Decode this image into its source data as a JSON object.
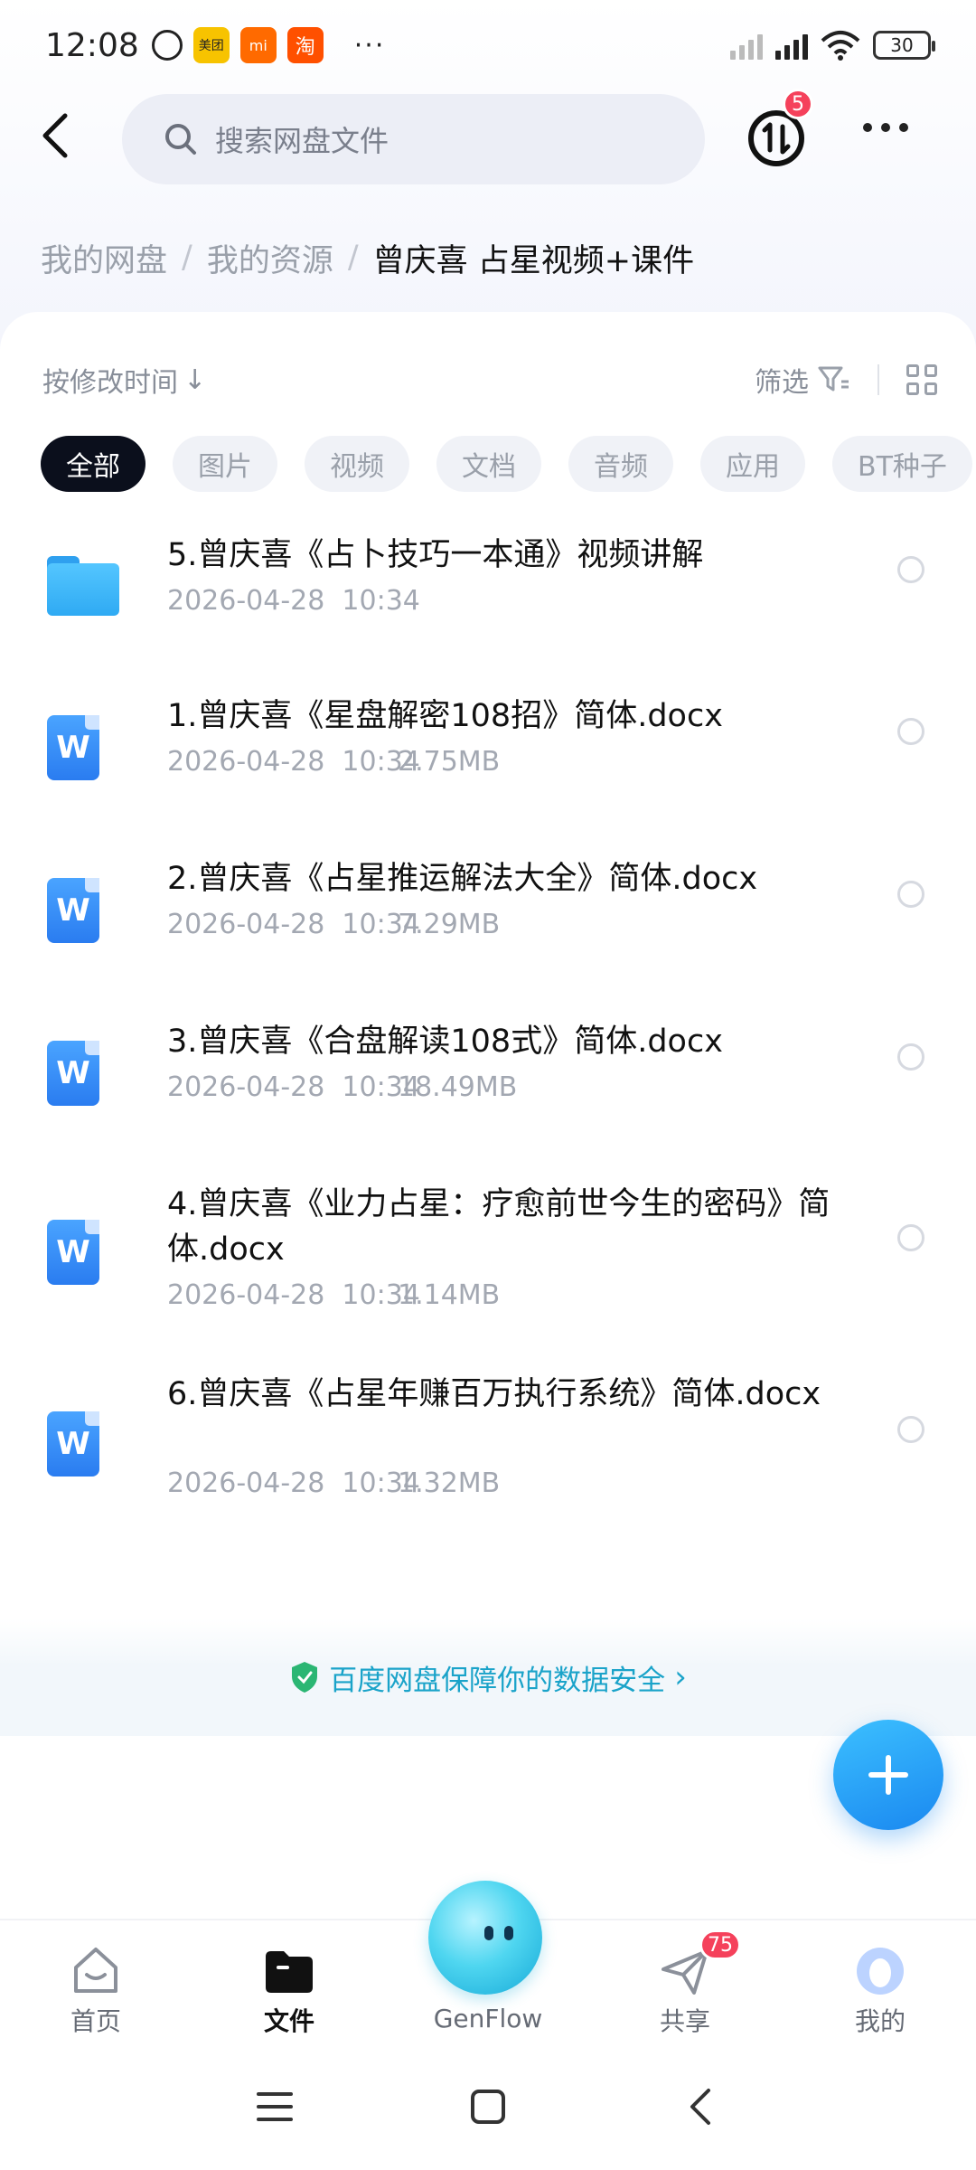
{
  "status_bar": {
    "time": "12:08",
    "app_icons": [
      "alarm-icon",
      "meituan-icon",
      "mi-icon",
      "taobao-icon"
    ],
    "meituan_label": "美团",
    "mi_label": "mi",
    "taobao_label": "淘",
    "more": "···",
    "battery": "30"
  },
  "header": {
    "search_placeholder": "搜索网盘文件",
    "transfer_badge": "5"
  },
  "breadcrumb": {
    "items": [
      "我的网盘",
      "我的资源",
      "曾庆喜 占星视频+课件"
    ],
    "separator": "/"
  },
  "toolbar": {
    "sort_label": "按修改时间",
    "sort_arrow": "↓",
    "filter_label": "筛选"
  },
  "chips": [
    "全部",
    "图片",
    "视频",
    "文档",
    "音频",
    "应用",
    "BT种子"
  ],
  "files": [
    {
      "type": "folder",
      "name": "5.曾庆喜《占卜技巧一本通》视频讲解",
      "date": "2026-04-28  10:34",
      "size": ""
    },
    {
      "type": "doc",
      "name": "1.曾庆喜《星盘解密108招》简体.docx",
      "date": "2026-04-28  10:34",
      "size": "2.75MB"
    },
    {
      "type": "doc",
      "name": "2.曾庆喜《占星推运解法大全》简体.docx",
      "date": "2026-04-28  10:34",
      "size": "7.29MB"
    },
    {
      "type": "doc",
      "name": "3.曾庆喜《合盘解读108式》简体.docx",
      "date": "2026-04-28  10:34",
      "size": "18.49MB"
    },
    {
      "type": "doc",
      "name": "4.曾庆喜《业力占星：疗愈前世今生的密码》简体.docx",
      "date": "2026-04-28  10:34",
      "size": "1.14MB"
    },
    {
      "type": "doc",
      "name": "6.曾庆喜《占星年赚百万执行系统》简体.docx",
      "date": "2026-04-28  10:34",
      "size": "1.32MB"
    }
  ],
  "doc_icon_letter": "W",
  "security_banner": {
    "text": "百度网盘保障你的数据安全",
    "chevron": "›"
  },
  "bottom_nav": {
    "items": [
      {
        "label": "首页",
        "icon": "home-icon"
      },
      {
        "label": "文件",
        "icon": "files-icon"
      },
      {
        "label": "GenFlow",
        "icon": "genflow-icon"
      },
      {
        "label": "共享",
        "icon": "share-icon"
      },
      {
        "label": "我的",
        "icon": "profile-icon"
      }
    ],
    "share_badge": "75",
    "active": "文件"
  },
  "colors": {
    "accent": "#1a88f0",
    "chip_active_bg": "#0b0f1c",
    "badge_red": "#f5415b",
    "security_text": "#1aa3c9"
  }
}
